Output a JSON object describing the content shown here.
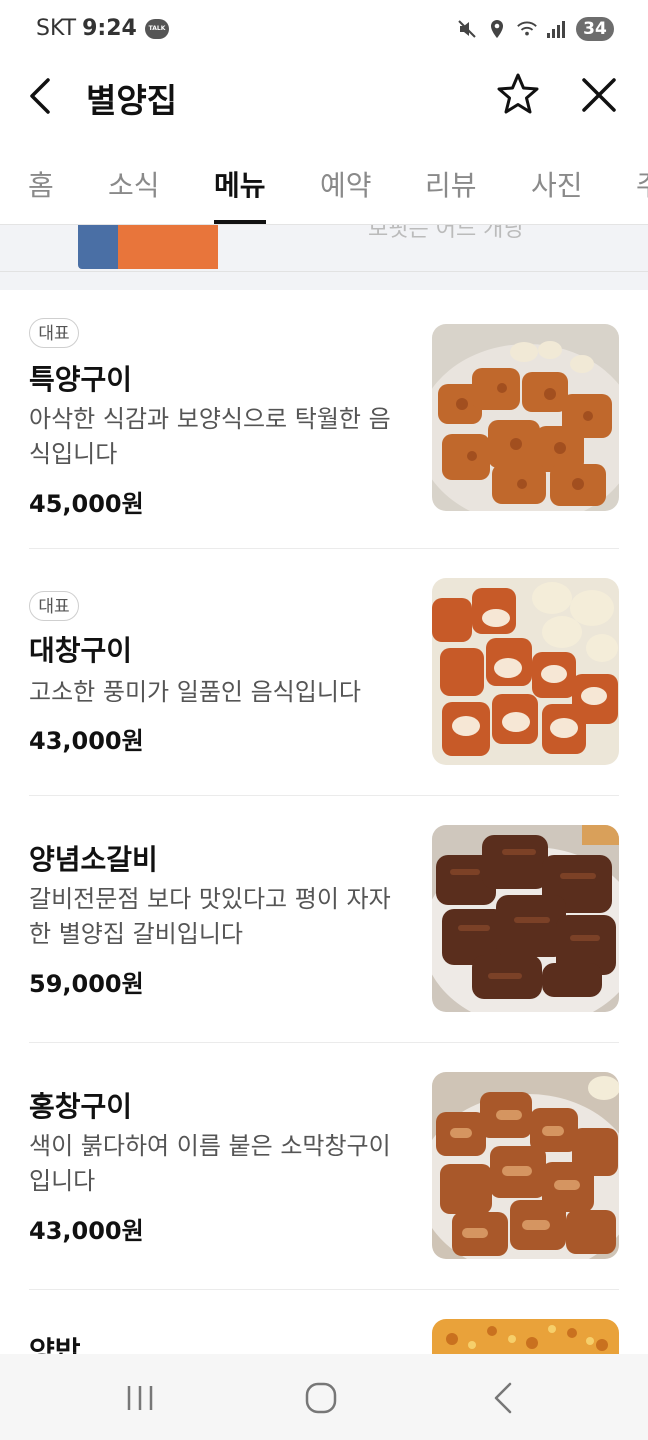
{
  "status_bar": {
    "carrier": "SKT",
    "time": "9:24",
    "talk_label": "TALK",
    "battery": "34"
  },
  "header": {
    "title": "별양집"
  },
  "tabs": [
    {
      "label": "홈"
    },
    {
      "label": "소식"
    },
    {
      "label": "메뉴"
    },
    {
      "label": "예약"
    },
    {
      "label": "리뷰"
    },
    {
      "label": "사진"
    },
    {
      "label": "주"
    }
  ],
  "banner": {
    "partial_text": "보핏는 어드 개닝"
  },
  "menu": [
    {
      "badge": "대표",
      "name": "특양구이",
      "desc": "아삭한 식감과 보양식으로 탁월한 음식입니다",
      "price": "45,000원"
    },
    {
      "badge": "대표",
      "name": "대창구이",
      "desc": "고소한 풍미가 일품인 음식입니다",
      "price": "43,000원"
    },
    {
      "badge": "",
      "name": "양념소갈비",
      "desc": "갈비전문점 보다 맛있다고 평이 자자한 별양집 갈비입니다",
      "price": "59,000원"
    },
    {
      "badge": "",
      "name": "홍창구이",
      "desc": "색이 붉다하여 이름 붙은 소막창구이입니다",
      "price": "43,000원"
    },
    {
      "badge": "",
      "name": "양밥",
      "desc": "",
      "price": ""
    }
  ]
}
